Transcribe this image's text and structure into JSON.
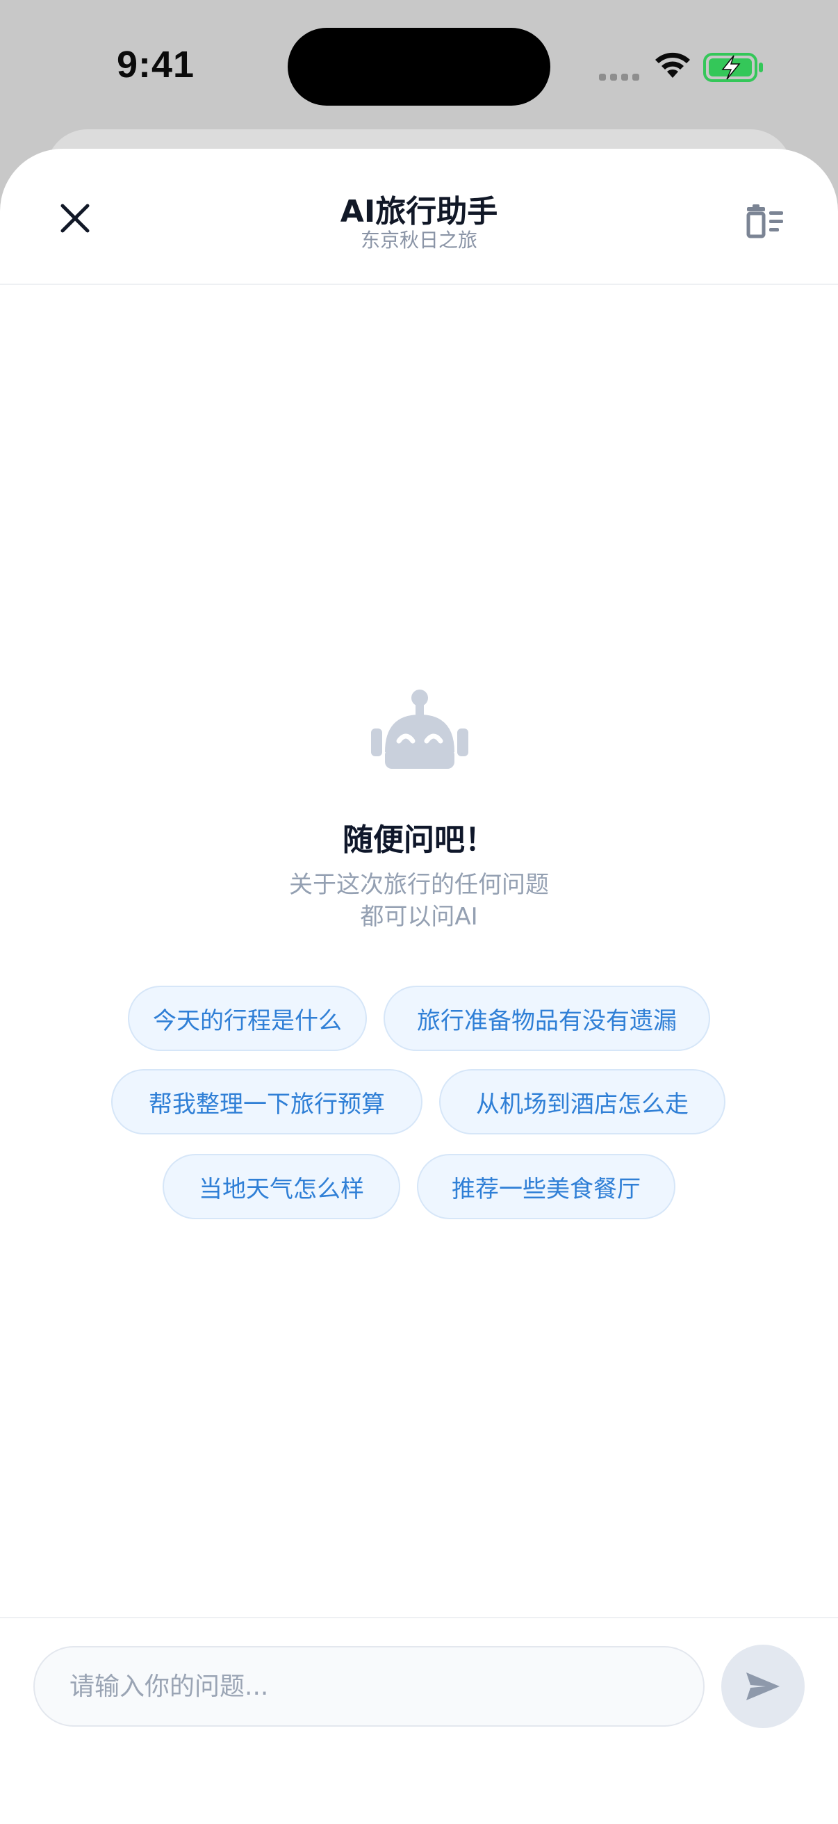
{
  "status_bar": {
    "time": "9:41"
  },
  "header": {
    "title": "AI旅行助手",
    "subtitle": "东京秋日之旅",
    "close_icon": "close-icon",
    "clear_icon": "clear-list-icon"
  },
  "empty_state": {
    "icon": "robot-icon",
    "title": "随便问吧！",
    "description_line1": "关于这次旅行的任何问题",
    "description_line2": "都可以问AI"
  },
  "suggestions": [
    "今天的行程是什么",
    "旅行准备物品有没有遗漏",
    "帮我整理一下旅行预算",
    "从机场到酒店怎么走",
    "当地天气怎么样",
    "推荐一些美食餐厅"
  ],
  "input": {
    "placeholder": "请输入你的问题...",
    "send_icon": "send-icon"
  },
  "colors": {
    "accent": "#2f7fd6",
    "chip_bg": "#eef6ff",
    "battery": "#34c759"
  }
}
